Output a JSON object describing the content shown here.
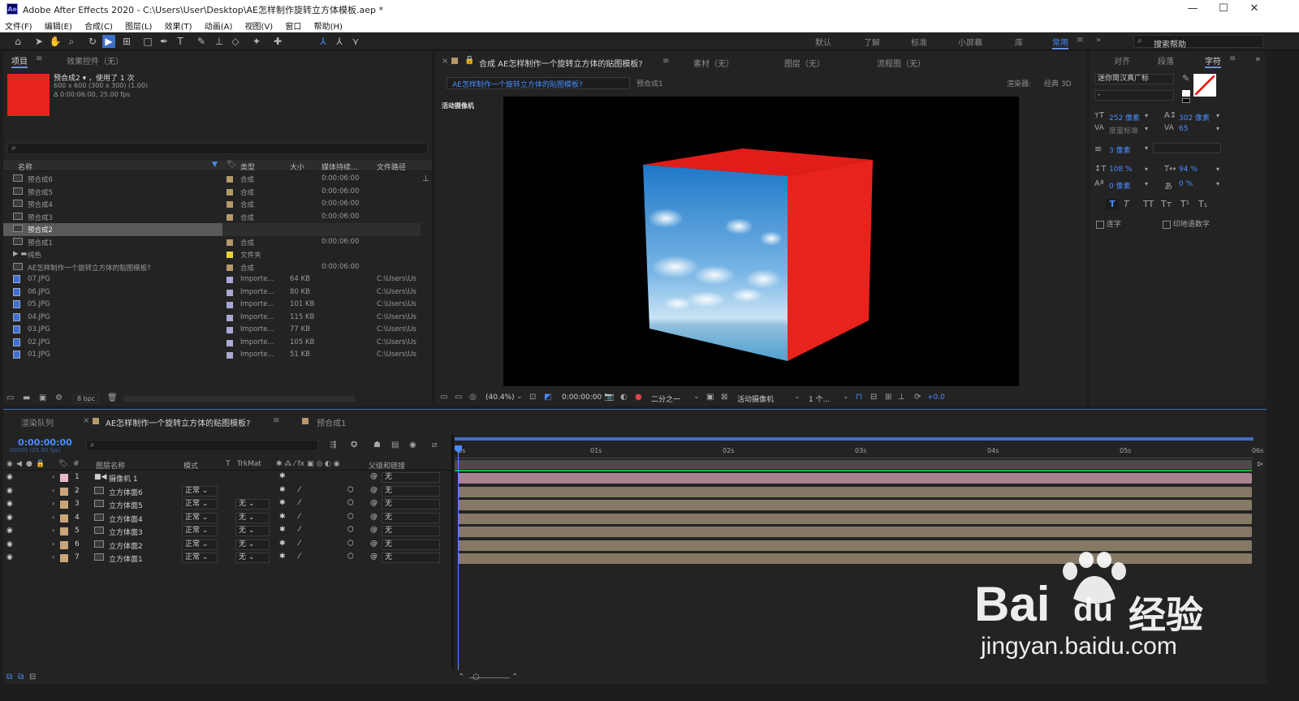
{
  "titlebar": {
    "logo": "Ae",
    "title": "Adobe After Effects 2020 - C:\\Users\\User\\Desktop\\AE怎样制作旋转立方体模板.aep *",
    "min": "—",
    "max": "☐",
    "close": "✕"
  },
  "menu": [
    "文件(F)",
    "编辑(E)",
    "合成(C)",
    "图层(L)",
    "效果(T)",
    "动画(A)",
    "视图(V)",
    "窗口",
    "帮助(H)"
  ],
  "workspaces": [
    "默认",
    "了解",
    "标准",
    "小屏幕",
    "库",
    "常用"
  ],
  "active_workspace": "常用",
  "search_help": "搜索帮助",
  "project": {
    "tab_project": "项目",
    "tab_effects": "效果控件（无）",
    "thumb_color": "#e8231e",
    "info_name": "预合成2",
    "info_used": "，使用了 1 次",
    "info_size": "600 x 600  (300 x 300) (1.00)",
    "info_duration": "Δ 0:00:06:00, 25.00 fps",
    "columns": [
      "名称",
      "类型",
      "大小",
      "媒体持续...",
      "文件路径"
    ],
    "items": [
      {
        "name": "预合成6",
        "type": "合成",
        "size": "",
        "dur": "0:00:06:00",
        "path": "",
        "icon": "comp",
        "color": "#b5986a",
        "selected": false
      },
      {
        "name": "预合成5",
        "type": "合成",
        "size": "",
        "dur": "0:00:06:00",
        "path": "",
        "icon": "comp",
        "color": "#b5986a",
        "selected": false
      },
      {
        "name": "预合成4",
        "type": "合成",
        "size": "",
        "dur": "0:00:06:00",
        "path": "",
        "icon": "comp",
        "color": "#b5986a",
        "selected": false
      },
      {
        "name": "预合成3",
        "type": "合成",
        "size": "",
        "dur": "0:00:06:00",
        "path": "",
        "icon": "comp",
        "color": "#b5986a",
        "selected": false
      },
      {
        "name": "预合成2",
        "type": "合成",
        "size": "",
        "dur": "0:00:06:00",
        "path": "",
        "icon": "comp",
        "color": "#b5986a",
        "selected": true
      },
      {
        "name": "预合成1",
        "type": "合成",
        "size": "",
        "dur": "0:00:06:00",
        "path": "",
        "icon": "comp",
        "color": "#b5986a",
        "selected": false
      },
      {
        "name": "纯色",
        "type": "文件夹",
        "size": "",
        "dur": "",
        "path": "",
        "icon": "folder",
        "color": "#e6d23a",
        "selected": false
      },
      {
        "name": "AE怎样制作一个旋转立方体的贴图模板?",
        "type": "合成",
        "size": "",
        "dur": "0:00:06:00",
        "path": "",
        "icon": "comp",
        "color": "#b5986a",
        "selected": false
      },
      {
        "name": "07.JPG",
        "type": "Importe...",
        "size": "64 KB",
        "dur": "",
        "path": "C:\\Users\\Us",
        "icon": "img",
        "color": "#a9a9d6",
        "selected": false
      },
      {
        "name": "06.JPG",
        "type": "Importe...",
        "size": "80 KB",
        "dur": "",
        "path": "C:\\Users\\Us",
        "icon": "img",
        "color": "#a9a9d6",
        "selected": false
      },
      {
        "name": "05.JPG",
        "type": "Importe...",
        "size": "101 KB",
        "dur": "",
        "path": "C:\\Users\\Us",
        "icon": "img",
        "color": "#a9a9d6",
        "selected": false
      },
      {
        "name": "04.JPG",
        "type": "Importe...",
        "size": "115 KB",
        "dur": "",
        "path": "C:\\Users\\Us",
        "icon": "img",
        "color": "#a9a9d6",
        "selected": false
      },
      {
        "name": "03.JPG",
        "type": "Importe...",
        "size": "77 KB",
        "dur": "",
        "path": "C:\\Users\\Us",
        "icon": "img",
        "color": "#a9a9d6",
        "selected": false
      },
      {
        "name": "02.JPG",
        "type": "Importe...",
        "size": "105 KB",
        "dur": "",
        "path": "C:\\Users\\Us",
        "icon": "img",
        "color": "#a9a9d6",
        "selected": false
      },
      {
        "name": "01.JPG",
        "type": "Importe...",
        "size": "51 KB",
        "dur": "",
        "path": "C:\\Users\\Us",
        "icon": "img",
        "color": "#a9a9d6",
        "selected": false
      }
    ],
    "bpc": "8 bpc"
  },
  "comp": {
    "tab_comp": "合成 AE怎样制作一个旋转立方体的贴图模板?",
    "tab_footage": "素材（无）",
    "tab_layer": "图层（无）",
    "tab_flow": "流程图（无）",
    "crumb_active": "AE怎样制作一个旋转立方体的贴图模板?",
    "crumb_other": "预合成1",
    "renderer_label": "渲染器:",
    "renderer": "经典 3D",
    "camera_label": "活动摄像机",
    "zoom": "(40.4%)",
    "time": "0:00:00:00",
    "resolution": "二分之一",
    "view": "活动摄像机",
    "views": "1 个...",
    "exposure": "+0.0"
  },
  "character": {
    "tab_align": "对齐",
    "tab_para": "段落",
    "tab_char": "字符",
    "font": "迷你简汉真广标",
    "style": "-",
    "size": "252 像素",
    "leading": "302 像素",
    "kerning": "度量标准",
    "tracking": "65",
    "stroke": "3 像素",
    "vscale": "108 %",
    "hscale": "94 %",
    "baseline": "0 像素",
    "tsume": "0 %",
    "styles": [
      "T",
      "T",
      "TT",
      "Tт",
      "T¹",
      "T₁"
    ],
    "ligature": "连字",
    "hindi": "印地语数字"
  },
  "timeline": {
    "tab_render": "渲染队列",
    "tab_comp": "AE怎样制作一个旋转立方体的贴图模板?",
    "tab_pre": "预合成1",
    "timecode": "0:00:00:00",
    "fps": "00000 (25.00 fps)",
    "col_name": "图层名称",
    "col_mode": "模式",
    "col_t": "T",
    "col_trk": "TrkMat",
    "col_parent": "父级和链接",
    "ruler": [
      "0s",
      "01s",
      "02s",
      "03s",
      "04s",
      "05s",
      "06s"
    ],
    "layers": [
      {
        "num": "1",
        "name": "摄像机 1",
        "color": "#e8b7c8",
        "type": "camera",
        "mode": "",
        "trk": "",
        "parent": "无",
        "bar": "#a7828f"
      },
      {
        "num": "2",
        "name": "立方体面6",
        "color": "#c9a57a",
        "type": "comp",
        "mode": "正常",
        "trk": "",
        "parent": "无",
        "bar": "#857965"
      },
      {
        "num": "3",
        "name": "立方体面5",
        "color": "#c9a57a",
        "type": "comp",
        "mode": "正常",
        "trk": "无",
        "parent": "无",
        "bar": "#857965"
      },
      {
        "num": "4",
        "name": "立方体面4",
        "color": "#c9a57a",
        "type": "comp",
        "mode": "正常",
        "trk": "无",
        "parent": "无",
        "bar": "#857965"
      },
      {
        "num": "5",
        "name": "立方体面3",
        "color": "#c9a57a",
        "type": "comp",
        "mode": "正常",
        "trk": "无",
        "parent": "无",
        "bar": "#857965"
      },
      {
        "num": "6",
        "name": "立方体面2",
        "color": "#c9a57a",
        "type": "comp",
        "mode": "正常",
        "trk": "无",
        "parent": "无",
        "bar": "#857965"
      },
      {
        "num": "7",
        "name": "立方体面1",
        "color": "#c9a57a",
        "type": "comp",
        "mode": "正常",
        "trk": "无",
        "parent": "无",
        "bar": "#857965"
      }
    ]
  },
  "watermark": {
    "brand": "Bai",
    "brand2": "du",
    "cn": "经验",
    "url": "jingyan.baidu.com"
  }
}
